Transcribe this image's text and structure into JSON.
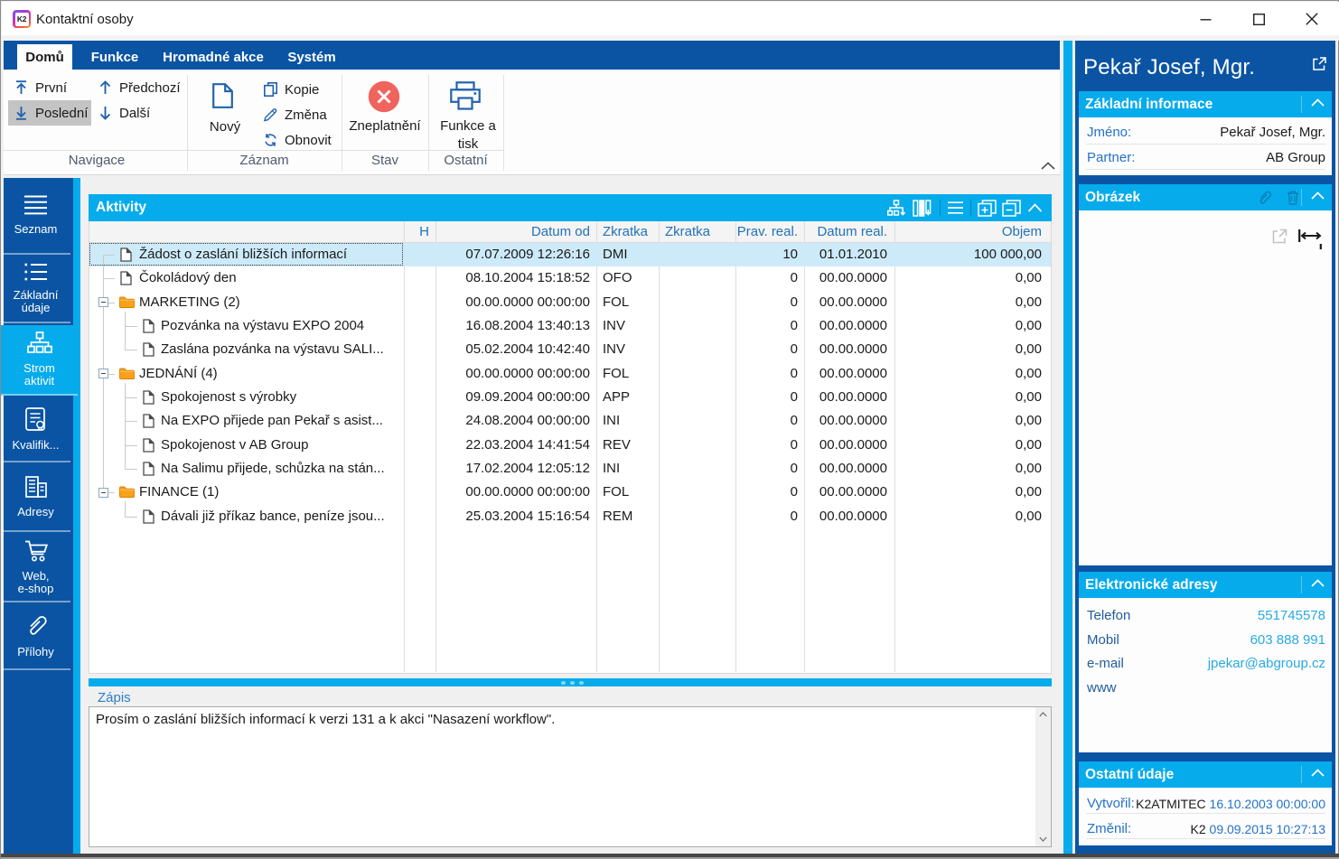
{
  "window": {
    "title": "Kontaktní osoby",
    "logo_text": "K2"
  },
  "ribbon": {
    "tabs": [
      {
        "label": "Domů",
        "active": true
      },
      {
        "label": "Funkce",
        "active": false
      },
      {
        "label": "Hromadné akce",
        "active": false
      },
      {
        "label": "Systém",
        "active": false
      }
    ],
    "navigace": {
      "group_label": "Navigace",
      "first": "První",
      "last": "Poslední",
      "previous": "Předchozí",
      "next": "Další"
    },
    "zaznam": {
      "group_label": "Záznam",
      "new": "Nový",
      "copy": "Kopie",
      "change": "Změna",
      "refresh": "Obnovit"
    },
    "stav": {
      "group_label": "Stav",
      "invalidate": "Zneplatnění"
    },
    "ostatni": {
      "group_label": "Ostatní",
      "print_line1": "Funkce a",
      "print_line2": "tisk"
    }
  },
  "sidebar": {
    "items": [
      {
        "label": "Seznam",
        "label2": "",
        "selected": false
      },
      {
        "label": "Základní",
        "label2": "údaje",
        "selected": false
      },
      {
        "label": "Strom",
        "label2": "aktivit",
        "selected": true
      },
      {
        "label": "Kvalifik...",
        "label2": "",
        "selected": false
      },
      {
        "label": "Adresy",
        "label2": "",
        "selected": false
      },
      {
        "label": "Web,",
        "label2": "e-shop",
        "selected": false
      },
      {
        "label": "Přílohy",
        "label2": "",
        "selected": false
      }
    ]
  },
  "activities": {
    "title": "Aktivity",
    "columns": [
      "H",
      "Datum od",
      "Zkratka",
      "Zkratka",
      "Prav. real.",
      "Datum real.",
      "Objem"
    ],
    "rows": [
      {
        "type": "doc",
        "level": 0,
        "selected": true,
        "name": "Žádost o zaslání bližších informací",
        "h": "",
        "datum_od": "07.07.2009 12:26:16",
        "zkratka": "DMI",
        "zkratka2": "",
        "prav_real": "10",
        "datum_real": "01.01.2010",
        "objem": "100 000,00"
      },
      {
        "type": "doc",
        "level": 0,
        "selected": false,
        "name": "Čokoládový den",
        "h": "",
        "datum_od": "08.10.2004 15:18:52",
        "zkratka": "OFO",
        "zkratka2": "",
        "prav_real": "0",
        "datum_real": "00.00.0000",
        "objem": "0,00"
      },
      {
        "type": "folder",
        "level": 0,
        "selected": false,
        "name": "MARKETING (2)",
        "h": "",
        "datum_od": "00.00.0000 00:00:00",
        "zkratka": "FOL",
        "zkratka2": "",
        "prav_real": "0",
        "datum_real": "00.00.0000",
        "objem": "0,00"
      },
      {
        "type": "doc",
        "level": 1,
        "selected": false,
        "name": "Pozvánka na výstavu EXPO 2004",
        "h": "",
        "datum_od": "16.08.2004 13:40:13",
        "zkratka": "INV",
        "zkratka2": "",
        "prav_real": "0",
        "datum_real": "00.00.0000",
        "objem": "0,00"
      },
      {
        "type": "doc",
        "level": 1,
        "selected": false,
        "name": "Zaslána pozvánka na výstavu SALI...",
        "h": "",
        "datum_od": "05.02.2004 10:42:40",
        "zkratka": "INV",
        "zkratka2": "",
        "prav_real": "0",
        "datum_real": "00.00.0000",
        "objem": "0,00"
      },
      {
        "type": "folder",
        "level": 0,
        "selected": false,
        "name": "JEDNÁNÍ (4)",
        "h": "",
        "datum_od": "00.00.0000 00:00:00",
        "zkratka": "FOL",
        "zkratka2": "",
        "prav_real": "0",
        "datum_real": "00.00.0000",
        "objem": "0,00"
      },
      {
        "type": "doc",
        "level": 1,
        "selected": false,
        "name": "Spokojenost s výrobky",
        "h": "",
        "datum_od": "09.09.2004 00:00:00",
        "zkratka": "APP",
        "zkratka2": "",
        "prav_real": "0",
        "datum_real": "00.00.0000",
        "objem": "0,00"
      },
      {
        "type": "doc",
        "level": 1,
        "selected": false,
        "name": "Na EXPO přijede pan Pekař s asist...",
        "h": "",
        "datum_od": "24.08.2004 00:00:00",
        "zkratka": "INI",
        "zkratka2": "",
        "prav_real": "0",
        "datum_real": "00.00.0000",
        "objem": "0,00"
      },
      {
        "type": "doc",
        "level": 1,
        "selected": false,
        "name": "Spokojenost v AB Group",
        "h": "",
        "datum_od": "22.03.2004 14:41:54",
        "zkratka": "REV",
        "zkratka2": "",
        "prav_real": "0",
        "datum_real": "00.00.0000",
        "objem": "0,00"
      },
      {
        "type": "doc",
        "level": 1,
        "selected": false,
        "name": "Na Salimu přijede, schůzka na stán...",
        "h": "",
        "datum_od": "17.02.2004 12:05:12",
        "zkratka": "INI",
        "zkratka2": "",
        "prav_real": "0",
        "datum_real": "00.00.0000",
        "objem": "0,00"
      },
      {
        "type": "folder",
        "level": 0,
        "selected": false,
        "name": "FINANCE (1)",
        "h": "",
        "datum_od": "00.00.0000 00:00:00",
        "zkratka": "FOL",
        "zkratka2": "",
        "prav_real": "0",
        "datum_real": "00.00.0000",
        "objem": "0,00"
      },
      {
        "type": "doc",
        "level": 1,
        "selected": false,
        "name": "Dávali již příkaz bance, peníze jsou...",
        "h": "",
        "datum_od": "25.03.2004 15:16:54",
        "zkratka": "REM",
        "zkratka2": "",
        "prav_real": "0",
        "datum_real": "00.00.0000",
        "objem": "0,00"
      }
    ]
  },
  "zapis": {
    "label": "Zápis",
    "text": "Prosím o zaslání bližších informací k verzi 131 a k akci \"Nasazení workflow\"."
  },
  "detail": {
    "name": "Pekař Josef, Mgr.",
    "zakladni": {
      "title": "Základní informace",
      "rows": [
        {
          "label": "Jméno:",
          "value": "Pekař Josef, Mgr."
        },
        {
          "label": "Partner:",
          "value": "AB Group"
        }
      ]
    },
    "obrazek": {
      "title": "Obrázek"
    },
    "adresy": {
      "title": "Elektronické adresy",
      "rows": [
        {
          "label": "Telefon",
          "value": "551745578"
        },
        {
          "label": "Mobil",
          "value": "603 888 991"
        },
        {
          "label": "e-mail",
          "value": "jpekar@abgroup.cz"
        },
        {
          "label": "www",
          "value": ""
        }
      ]
    },
    "ostatni": {
      "title": "Ostatní údaje",
      "rows": [
        {
          "label": "Vytvořil:",
          "who": "K2ATMITEC",
          "when": "16.10.2003 00:00:00"
        },
        {
          "label": "Změnil:",
          "who": "K2",
          "when": "09.09.2015 10:27:13"
        }
      ]
    }
  },
  "colors": {
    "brand_blue": "#0B54A3",
    "accent_blue": "#06ABEC",
    "selected_row": "#CDEAF9",
    "invalid_red": "#F1635D",
    "ribbon_icon_blue": "#2263AC",
    "table_header_text": "#2272B9",
    "main_background": "#F0F0F0"
  }
}
